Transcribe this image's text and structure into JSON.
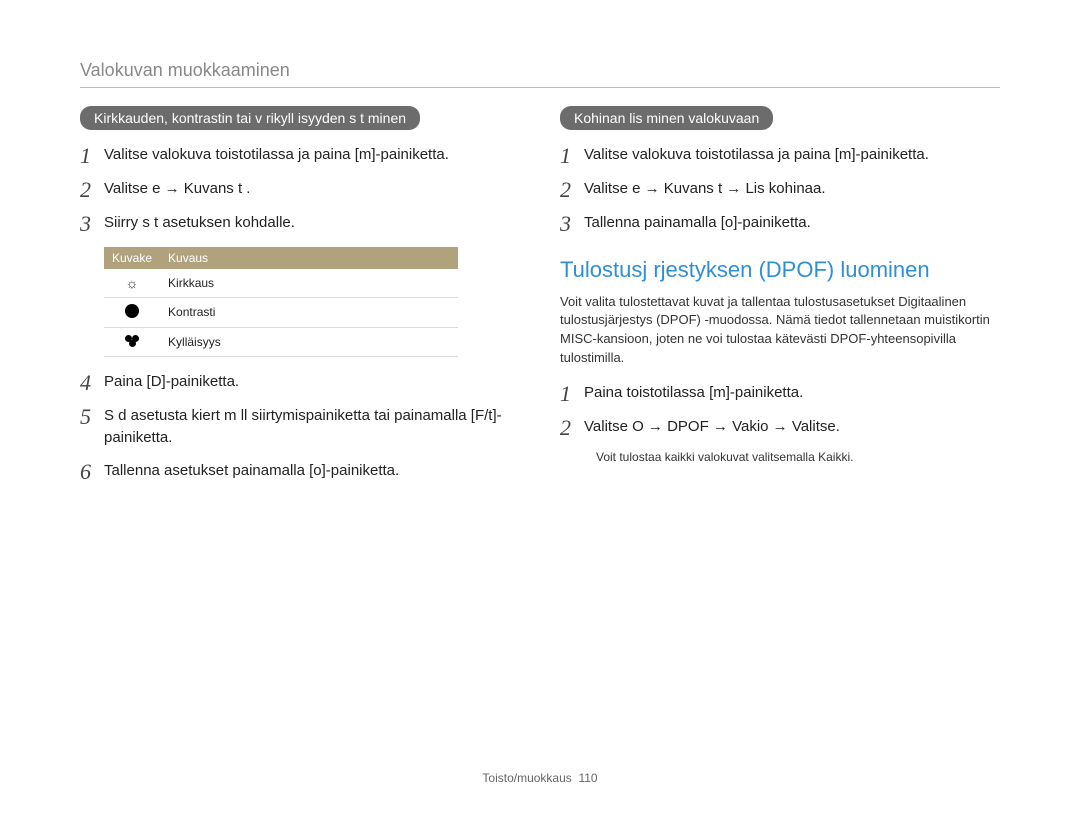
{
  "pageTitle": "Valokuvan muokkaaminen",
  "left": {
    "pill": "Kirkkauden, kontrastin tai v rikyll isyyden s t minen",
    "steps": {
      "1": "Valitse valokuva toistotilassa ja paina [m]-painiketta.",
      "2": "Valitse e → Kuvans t .",
      "3": "Siirry s t asetuksen kohdalle.",
      "4": "Paina [D]-painiketta.",
      "5": "S d asetusta kiert m ll  siirtymispainiketta tai painamalla [F/t]-painiketta.",
      "6": "Tallenna asetukset painamalla [o]-painiketta."
    },
    "table": {
      "hIcon": "Kuvake",
      "hDesc": "Kuvaus",
      "rows": [
        {
          "iconName": "brightness-icon",
          "glyph": "☼",
          "desc": "Kirkkaus"
        },
        {
          "iconName": "contrast-icon",
          "glyph": "◐",
          "desc": "Kontrasti"
        },
        {
          "iconName": "saturation-icon",
          "glyph": "",
          "desc": "Kylläisyys"
        }
      ]
    }
  },
  "right": {
    "pill": "Kohinan lis  minen valokuvaan",
    "steps": {
      "1": "Valitse valokuva toistotilassa ja paina [m]-painiketta.",
      "2": "Valitse e → Kuvans t  → Lis   kohinaa.",
      "3": "Tallenna painamalla [o]-painiketta."
    },
    "h2": "Tulostusj rjestyksen (DPOF) luominen",
    "para": "Voit valita tulostettavat kuvat ja tallentaa tulostusasetukset Digitaalinen tulostusjärjestys (DPOF) -muodossa. Nämä tiedot tallennetaan muistikortin MISC-kansioon, joten ne voi tulostaa kätevästi DPOF-yhteensopivilla tulostimilla.",
    "dsteps": {
      "1": "Paina toistotilassa [m]-painiketta.",
      "2": "Valitse O → DPOF → Vakio → Valitse."
    },
    "note": "Voit tulostaa kaikki valokuvat valitsemalla Kaikki."
  },
  "footer": {
    "section": "Toisto/muokkaus",
    "page": "110"
  }
}
